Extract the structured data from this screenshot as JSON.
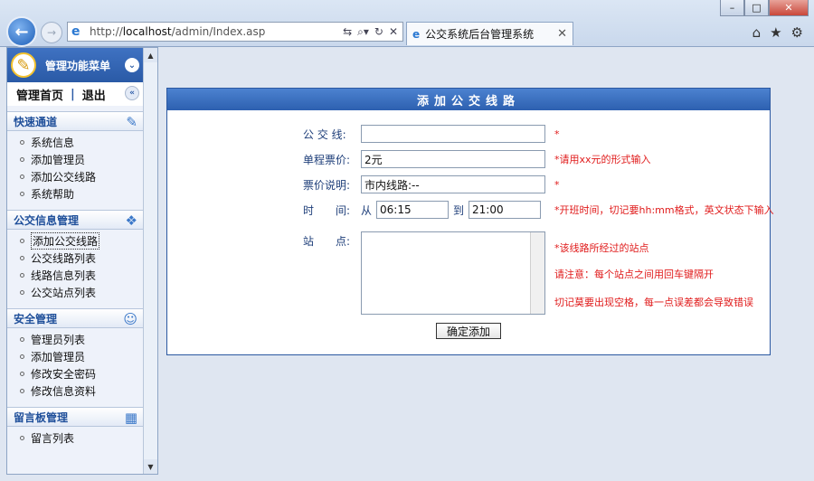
{
  "browser": {
    "address": "http://localhost/admin/Index.asp",
    "address_prefix": "http://",
    "address_host": "localhost",
    "address_path": "/admin/Index.asp",
    "tab_title": "公交系统后台管理系统",
    "window_buttons": [
      "–",
      "□",
      "✕"
    ],
    "icons": [
      "home-icon",
      "star-icon",
      "gear-icon"
    ]
  },
  "sidebar": {
    "header": "管理功能菜单",
    "home_link": "管理首页",
    "separator": "|",
    "logout_link": "退出",
    "sections": [
      {
        "title": "快速通道",
        "icon": "edit-icon",
        "items": [
          "系统信息",
          "添加管理员",
          "添加公交线路",
          "系统帮助"
        ]
      },
      {
        "title": "公交信息管理",
        "icon": "network-icon",
        "items": [
          "添加公交线路",
          "公交线路列表",
          "线路信息列表",
          "公交站点列表"
        ]
      },
      {
        "title": "安全管理",
        "icon": "user-icon",
        "items": [
          "管理员列表",
          "添加管理员",
          "修改安全密码",
          "修改信息资料"
        ]
      },
      {
        "title": "留言板管理",
        "icon": "calendar-icon",
        "items": [
          "留言列表"
        ]
      }
    ]
  },
  "form": {
    "title": "添加公交线路",
    "line_label": "公 交 线:",
    "line_value": "",
    "line_hint": "*",
    "fare_label": "单程票价:",
    "fare_value": "2元",
    "fare_hint": "*请用xx元的形式输入",
    "fare_desc_label": "票价说明:",
    "fare_desc_value": "市内线路:--",
    "fare_desc_hint": "*",
    "time_label": "时　　间:",
    "from_label": "从",
    "from_value": "06:15",
    "to_label": "到",
    "to_value": "21:00",
    "time_hint": "*开班时间，切记要hh:mm格式，英文状态下输入",
    "stops_label": "站　　点:",
    "stops_hint_1": "*该线路所经过的站点",
    "stops_hint_2": "请注意：每个站点之间用回车键隔开",
    "stops_hint_3": "切记莫要出现空格，每一点误差都会导致错误",
    "submit_label": "确定添加"
  },
  "colors": {
    "accent": "#2b58a1",
    "hint_red": "#e01b1b",
    "page_bg": "#dfe6f1"
  }
}
